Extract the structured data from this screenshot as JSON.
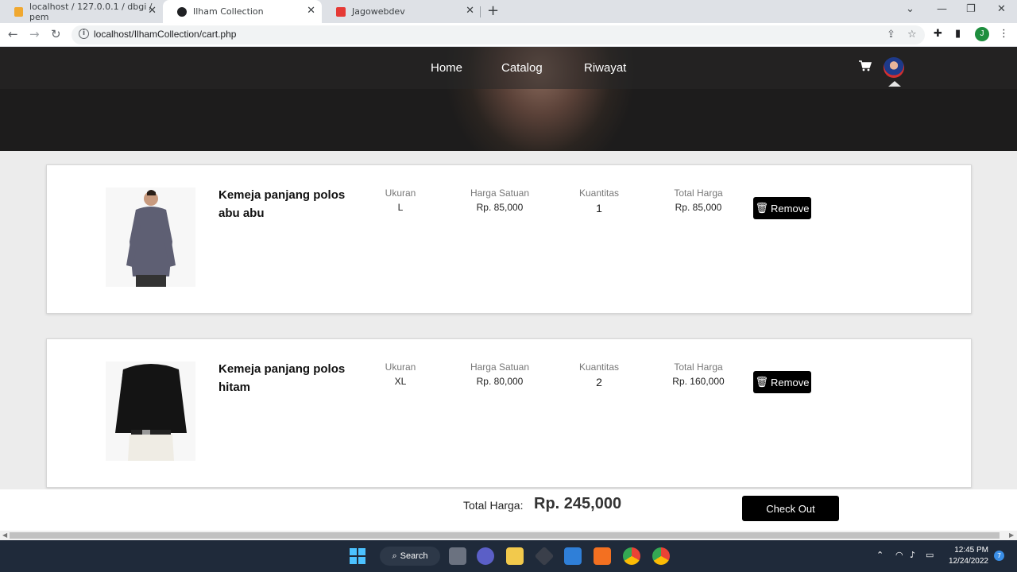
{
  "browser": {
    "tabs": [
      {
        "title": "localhost / 127.0.0.1 / dbgi / pem",
        "active": false
      },
      {
        "title": "Ilham Collection",
        "active": true
      },
      {
        "title": "Jagowebdev",
        "active": false
      }
    ],
    "url": "localhost/IlhamCollection/cart.php",
    "profile_initial": "J"
  },
  "site": {
    "nav": [
      "Home",
      "Catalog",
      "Riwayat"
    ],
    "icons": {
      "cart": "cart-icon",
      "avatar": "user-avatar"
    }
  },
  "cart": {
    "headers": {
      "size": "Ukuran",
      "unit_price": "Harga Satuan",
      "qty": "Kuantitas",
      "total": "Total Harga"
    },
    "remove_label": "Remove",
    "items": [
      {
        "name": "Kemeja panjang polos abu abu",
        "size": "L",
        "unit_price": "Rp. 85,000",
        "qty": "1",
        "total": "Rp. 85,000",
        "shirt_color": "#5e5f73"
      },
      {
        "name": "Kemeja panjang polos hitam",
        "size": "XL",
        "unit_price": "Rp. 80,000",
        "qty": "2",
        "total": "Rp. 160,000",
        "shirt_color": "#141414"
      }
    ],
    "grand_total_label": "Total Harga:",
    "grand_total": "Rp. 245,000",
    "checkout_label": "Check Out"
  },
  "taskbar": {
    "search_label": "Search",
    "time": "12:45 PM",
    "date": "12/24/2022",
    "notifications": "7"
  }
}
